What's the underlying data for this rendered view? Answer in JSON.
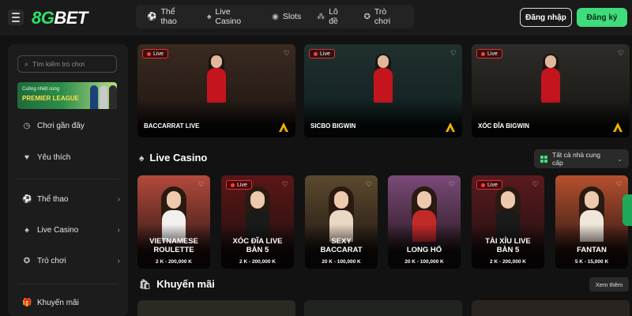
{
  "brand": {
    "logo_num": "8G",
    "logo_text": "BET"
  },
  "nav": [
    {
      "label": "Thể thao",
      "icon": "soccer-ball-icon"
    },
    {
      "label": "Live Casino",
      "icon": "poker-chip-icon"
    },
    {
      "label": "Slots",
      "icon": "slot-icon"
    },
    {
      "label": "Lô đề",
      "icon": "lottery-icon"
    },
    {
      "label": "Trò chơi",
      "icon": "game-icon"
    }
  ],
  "auth": {
    "login": "Đăng nhập",
    "register": "Đăng ký"
  },
  "sidebar": {
    "search_placeholder": "Tìm kiếm trò chơi",
    "banner": {
      "line1": "Cuồng nhiệt cùng",
      "line2": "PREMIER LEAGUE"
    },
    "items": [
      {
        "label": "Chơi gần đây",
        "icon": "clock-icon"
      },
      {
        "label": "Yêu thích",
        "icon": "heart-icon"
      },
      {
        "label": "Thể thao",
        "icon": "soccer-ball-icon"
      },
      {
        "label": "Live Casino",
        "icon": "poker-chip-icon"
      },
      {
        "label": "Trò chơi",
        "icon": "game-icon"
      },
      {
        "label": "Khuyến mãi",
        "icon": "gift-icon"
      }
    ]
  },
  "featured": [
    {
      "title": "BACCARRAT LIVE",
      "live": "Live",
      "color": "#3a2a20"
    },
    {
      "title": "SICBO BIGWIN",
      "live": "Live",
      "color": "#1b3a3c"
    },
    {
      "title": "XÓC ĐĨA BIGWIN",
      "live": "Live",
      "color": "#2e2c28"
    }
  ],
  "live_casino": {
    "title": "Live Casino",
    "provider_filter": "Tất cả nhà cung cấp",
    "games": [
      {
        "title_1": "VIETNAMESE",
        "title_2": "ROULETTE",
        "range": "2 K - 200,000 K",
        "live": "",
        "bg": "#b34a3c",
        "outfit": "#f2f0ee"
      },
      {
        "title_1": "XÓC ĐĨA LIVE",
        "title_2": "BÀN 5",
        "range": "2 K - 200,000 K",
        "live": "Live",
        "bg": "#5c1616",
        "outfit": "#1a1a1a"
      },
      {
        "title_1": "SEXY",
        "title_2": "BACCARAT",
        "range": "20 K - 100,000 K",
        "live": "",
        "bg": "#5b4a2e",
        "outfit": "#e9d8c3"
      },
      {
        "title_1": "LONG HỔ",
        "title_2": "",
        "range": "20 K - 100,000 K",
        "live": "",
        "bg": "#7a4a78",
        "outfit": "#c22a2a"
      },
      {
        "title_1": "TÀI XỈU LIVE",
        "title_2": "BÀN 5",
        "range": "2 K - 200,000 K",
        "live": "Live",
        "bg": "#5a1a1e",
        "outfit": "#1a1a1a"
      },
      {
        "title_1": "FANTAN",
        "title_2": "",
        "range": "5 K - 15,000 K",
        "live": "",
        "bg": "#b5502e",
        "outfit": "#f0e6da"
      }
    ]
  },
  "promotions": {
    "title": "Khuyến mãi",
    "more": "Xem thêm"
  }
}
